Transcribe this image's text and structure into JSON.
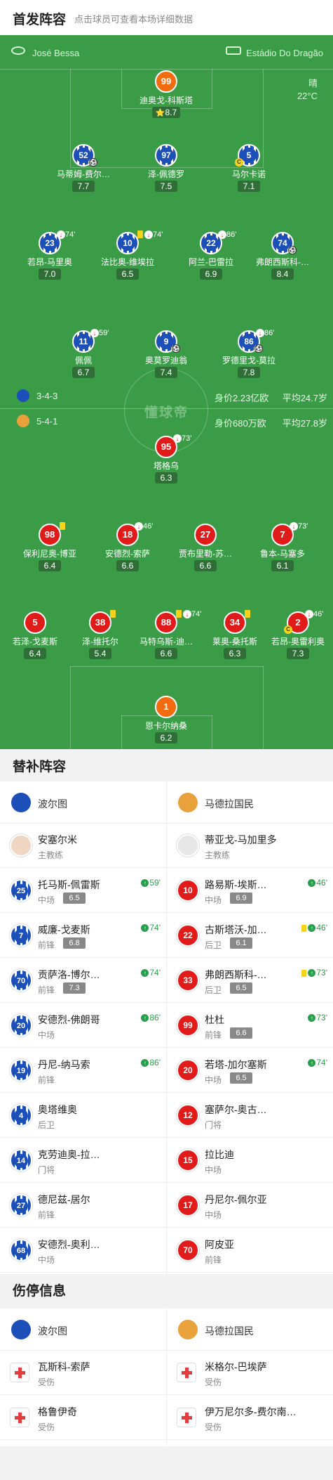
{
  "header": {
    "title": "首发阵容",
    "subtitle": "点击球员可查看本场详细数据"
  },
  "pitch": {
    "stadium_left": "José Bessa",
    "stadium_right": "Estádio Do Dragão",
    "weather": "晴",
    "temperature": "22°C",
    "watermark": "懂球帝",
    "home_formation": {
      "formation": "3-4-3",
      "value": "身价2.23亿欧",
      "avg_age": "平均24.7岁"
    },
    "away_formation": {
      "formation": "5-4-1",
      "value": "身价680万欧",
      "avg_age": "平均27.8岁"
    }
  },
  "home_players": [
    {
      "num": "99",
      "name": "迪奥戈-科斯塔",
      "rating": "8.7",
      "kit": "gk",
      "star": "⭐"
    },
    {
      "num": "52",
      "name": "马蒂姆-费尔…",
      "rating": "7.7",
      "kit": "home",
      "ball": "⚽"
    },
    {
      "num": "97",
      "name": "泽-佩德罗",
      "rating": "7.5",
      "kit": "home"
    },
    {
      "num": "5",
      "name": "马尔卡诺",
      "rating": "7.1",
      "kit": "home",
      "captain": "C"
    },
    {
      "num": "23",
      "name": "若昂-马里奥",
      "rating": "7.0",
      "kit": "home",
      "sub": "74'"
    },
    {
      "num": "10",
      "name": "法比奥-维埃拉",
      "rating": "6.5",
      "kit": "home",
      "sub": "74'",
      "card": true
    },
    {
      "num": "22",
      "name": "阿兰-巴雷拉",
      "rating": "6.9",
      "kit": "home",
      "sub": "86'"
    },
    {
      "num": "74",
      "name": "弗朗西斯科-…",
      "rating": "8.4",
      "kit": "home",
      "ball": "⚽"
    },
    {
      "num": "11",
      "name": "佩佩",
      "rating": "6.7",
      "kit": "home",
      "sub": "59'"
    },
    {
      "num": "9",
      "name": "奥莫罗迪翁",
      "rating": "7.4",
      "kit": "home",
      "ball": "⚽"
    },
    {
      "num": "86",
      "name": "罗德里戈-莫拉",
      "rating": "7.8",
      "kit": "home",
      "sub": "86'",
      "ball": "⚽"
    }
  ],
  "away_players": [
    {
      "num": "95",
      "name": "塔格乌",
      "rating": "6.3",
      "kit": "away",
      "sub": "73'"
    },
    {
      "num": "98",
      "name": "保利尼奥-博亚",
      "rating": "6.4",
      "kit": "away",
      "card": true
    },
    {
      "num": "18",
      "name": "安德烈-索萨",
      "rating": "6.6",
      "kit": "away",
      "sub": "46'"
    },
    {
      "num": "27",
      "name": "贾布里勒-苏…",
      "rating": "6.6",
      "kit": "away"
    },
    {
      "num": "7",
      "name": "鲁本-马塞多",
      "rating": "6.1",
      "kit": "away",
      "sub": "73'"
    },
    {
      "num": "5",
      "name": "若泽-戈麦斯",
      "rating": "6.4",
      "kit": "away"
    },
    {
      "num": "38",
      "name": "泽-维托尔",
      "rating": "5.4",
      "kit": "away",
      "card": true
    },
    {
      "num": "88",
      "name": "马特乌斯-迪…",
      "rating": "6.6",
      "kit": "away",
      "sub": "74'",
      "card": true
    },
    {
      "num": "34",
      "name": "莱奥-桑托斯",
      "rating": "6.3",
      "kit": "away",
      "card": true
    },
    {
      "num": "2",
      "name": "若昂-奥雷利奥",
      "rating": "7.3",
      "kit": "away",
      "sub": "46'",
      "captain": "C"
    },
    {
      "num": "1",
      "name": "恩卡尔纳桑",
      "rating": "6.2",
      "kit": "gk"
    }
  ],
  "subs": {
    "title": "替补阵容",
    "home_team": "波尔图",
    "away_team": "马德拉国民",
    "home": [
      {
        "name": "安塞尔米",
        "pos": "主教练",
        "kind": "coach"
      },
      {
        "num": "25",
        "name": "托马斯-佩雷斯",
        "pos": "中场",
        "rating": "6.5",
        "time": "59'"
      },
      {
        "num": "7",
        "name": "威廉-戈麦斯",
        "pos": "前锋",
        "rating": "6.8",
        "time": "74'"
      },
      {
        "num": "70",
        "name": "贡萨洛-博尔…",
        "pos": "前锋",
        "rating": "7.3",
        "time": "74'"
      },
      {
        "num": "20",
        "name": "安德烈-佛朗哥",
        "pos": "中场",
        "time": "86'"
      },
      {
        "num": "19",
        "name": "丹尼-纳马索",
        "pos": "前锋",
        "time": "86'"
      },
      {
        "num": "4",
        "name": "奥塔维奥",
        "pos": "后卫"
      },
      {
        "num": "14",
        "name": "克劳迪奥-拉…",
        "pos": "门将"
      },
      {
        "num": "27",
        "name": "德尼兹-居尔",
        "pos": "前锋"
      },
      {
        "num": "68",
        "name": "安德烈-奥利…",
        "pos": "中场"
      }
    ],
    "away": [
      {
        "name": "蒂亚戈-马加里多",
        "pos": "主教练",
        "kind": "coach-gray"
      },
      {
        "num": "10",
        "name": "路易斯-埃斯…",
        "pos": "中场",
        "rating": "6.9",
        "time": "46'"
      },
      {
        "num": "22",
        "name": "古斯塔沃-加…",
        "pos": "后卫",
        "rating": "6.1",
        "time": "46'",
        "card": true
      },
      {
        "num": "33",
        "name": "弗朗西斯科-…",
        "pos": "后卫",
        "rating": "6.5",
        "time": "73'",
        "card": true
      },
      {
        "num": "99",
        "name": "杜杜",
        "pos": "前锋",
        "rating": "6.6",
        "time": "73'"
      },
      {
        "num": "20",
        "name": "若塔-加尔塞斯",
        "pos": "中场",
        "rating": "6.5",
        "time": "74'"
      },
      {
        "num": "12",
        "name": "塞萨尔-奥古…",
        "pos": "门将"
      },
      {
        "num": "15",
        "name": "拉比迪",
        "pos": "中场"
      },
      {
        "num": "17",
        "name": "丹尼尔-佩尔亚",
        "pos": "中场"
      },
      {
        "num": "70",
        "name": "阿皮亚",
        "pos": "前锋"
      }
    ]
  },
  "injuries": {
    "title": "伤停信息",
    "home_team": "波尔图",
    "away_team": "马德拉国民",
    "home": [
      {
        "name": "瓦斯科-索萨",
        "status": "受伤"
      },
      {
        "name": "格鲁伊奇",
        "status": "受伤"
      }
    ],
    "away": [
      {
        "name": "米格尔-巴埃萨",
        "status": "受伤"
      },
      {
        "name": "伊万尼尔多-费尔南…",
        "status": "受伤"
      }
    ]
  }
}
